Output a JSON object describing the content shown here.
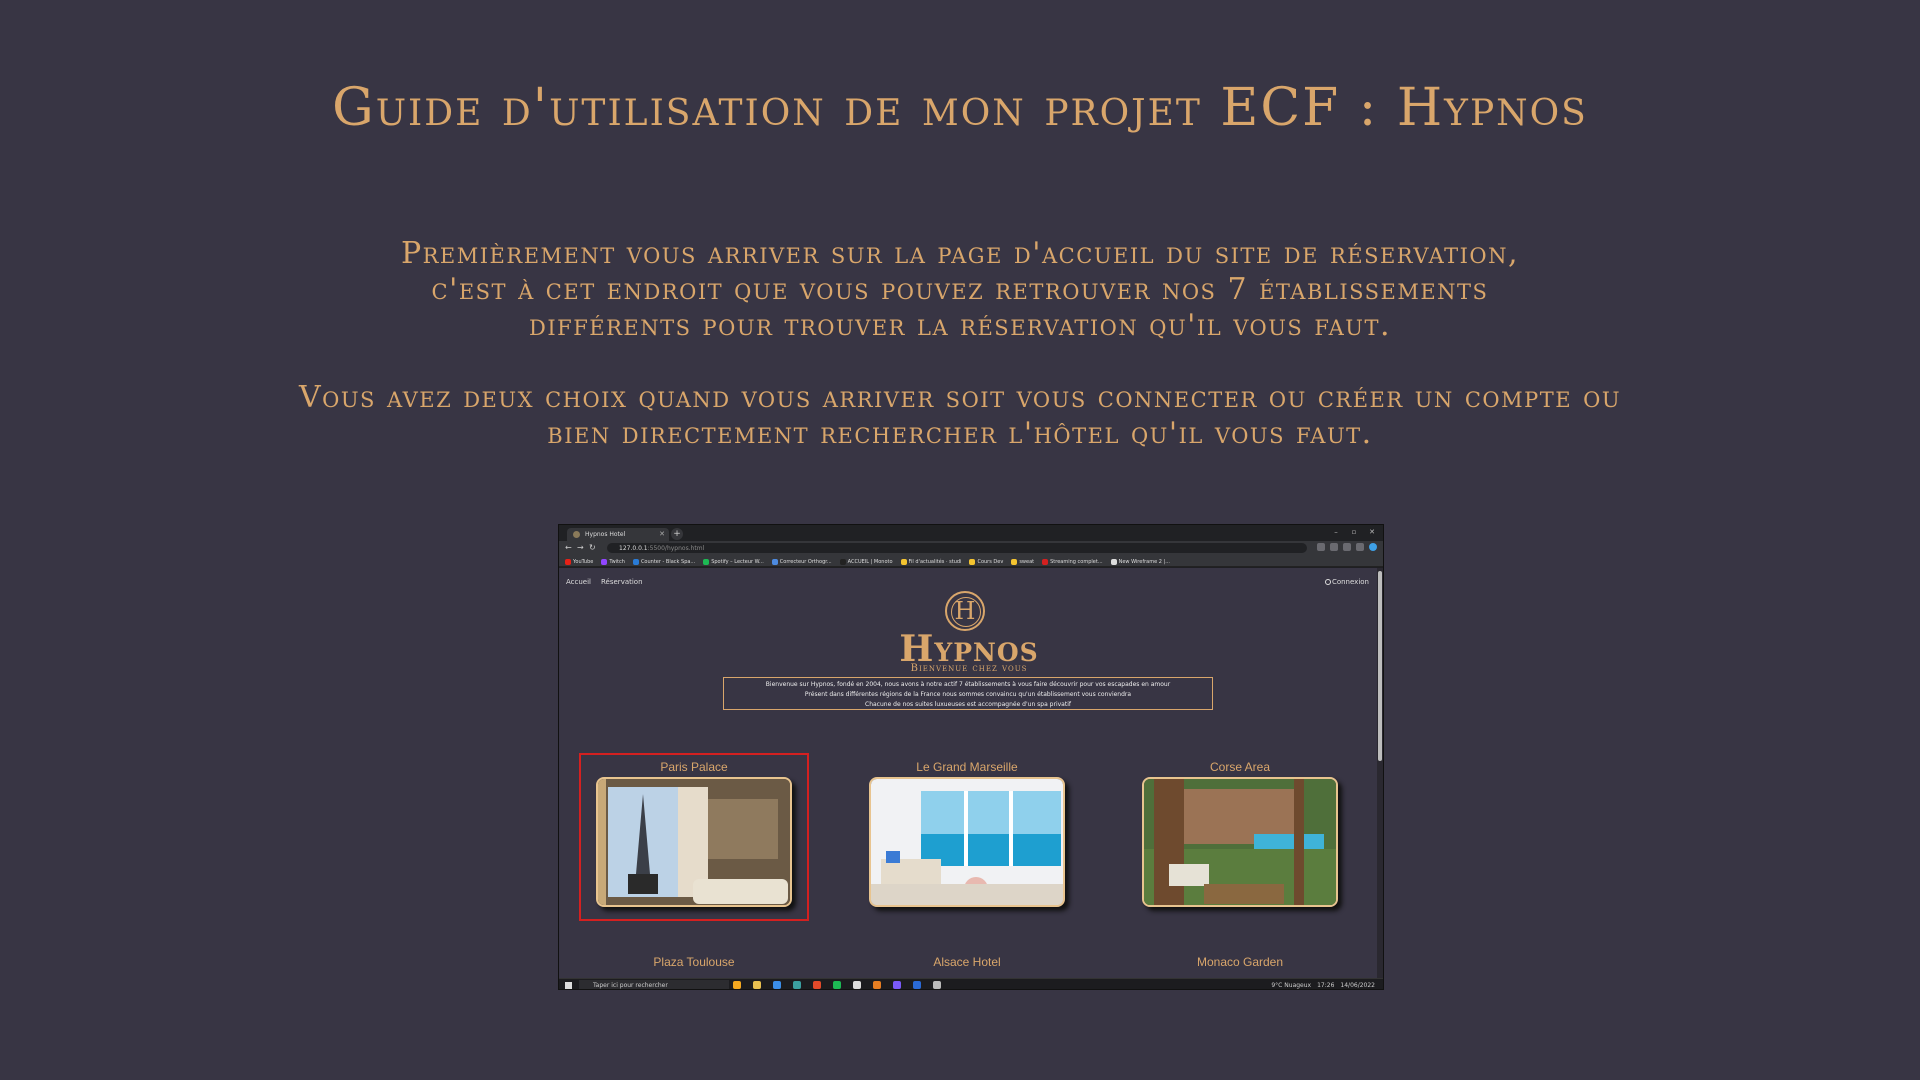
{
  "slide": {
    "title": "Guide d'utilisation de mon projet ECF : Hypnos",
    "paragraph1": [
      "Premièrement vous arriver sur la page d'accueil du site de réservation,",
      "c'est à cet endroit que vous pouvez retrouver nos 7 établissements",
      "différents pour trouver la réservation qu'il vous faut."
    ],
    "paragraph2": [
      "Vous avez deux choix quand vous arriver soit vous connecter ou créer un compte ou",
      "bien directement rechercher l'hôtel qu'il vous faut."
    ]
  },
  "browser": {
    "tab_title": "Hypnos Hotel",
    "url_host": "127.0.0.1",
    "url_path": ":5500/hypnos.html",
    "bookmarks": [
      {
        "label": "YouTube",
        "color": "#e62117"
      },
      {
        "label": "Twitch",
        "color": "#9146ff"
      },
      {
        "label": "Counter - Black Spa...",
        "color": "#2a7bd6"
      },
      {
        "label": "Spotify – Lecteur W...",
        "color": "#1db954"
      },
      {
        "label": "Correcteur Orthogr...",
        "color": "#4d8ae0"
      },
      {
        "label": "ACCUEIL | Monoto",
        "color": "#222"
      },
      {
        "label": "Fil d'actualités · studi",
        "color": "#f4c430"
      },
      {
        "label": "Cours Dev",
        "color": "#f4c430"
      },
      {
        "label": "sweat",
        "color": "#f4c430"
      },
      {
        "label": "Streaming complet...",
        "color": "#d42020"
      },
      {
        "label": "New Wireframe 2 |...",
        "color": "#ddd"
      }
    ]
  },
  "site": {
    "nav": {
      "home": "Accueil",
      "reservation": "Réservation",
      "login": "Connexion"
    },
    "brand": "Hypnos",
    "emblem": "H",
    "tagline": "Bienvenue chez vous",
    "welcome_lines": [
      "Bienvenue sur Hypnos, fondé en 2004, nous avons à notre actif 7 établissements à vous faire découvrir pour vos escapades en amour",
      "Présent dans différentes régions de la France nous sommes convaincu qu'un établissement vous conviendra",
      "Chacune de nos suites luxueuses est accompagnée d'un spa privatif"
    ],
    "hotels": [
      {
        "name": "Paris Palace"
      },
      {
        "name": "Le Grand Marseille"
      },
      {
        "name": "Corse Area"
      },
      {
        "name": "Plaza Toulouse"
      },
      {
        "name": "Alsace Hotel"
      },
      {
        "name": "Monaco Garden"
      }
    ]
  },
  "taskbar": {
    "search_placeholder": "Taper ici pour rechercher",
    "weather": "9°C  Nuageux",
    "time": "17:26",
    "date": "14/06/2022",
    "app_colors": [
      "#f4a820",
      "#e8c050",
      "#3b8ee8",
      "#3ba0a0",
      "#e24a2a",
      "#1db954",
      "#ddd",
      "#e67e22",
      "#7a5af8",
      "#2a6ad6",
      "#bbb"
    ]
  },
  "colors": {
    "background": "#383544",
    "gold": "#d9a66b",
    "highlight": "#d42020"
  }
}
